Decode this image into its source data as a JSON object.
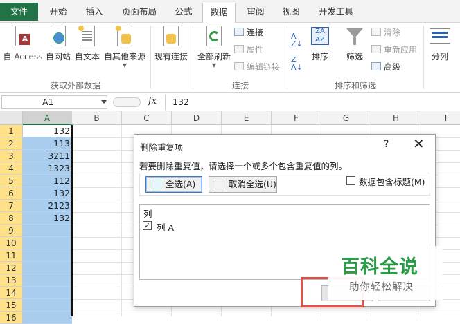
{
  "ribbon_tabs": [
    "文件",
    "开始",
    "插入",
    "页面布局",
    "公式",
    "数据",
    "审阅",
    "视图",
    "开发工具"
  ],
  "active_tab": "数据",
  "get_external": {
    "access": "自 Access",
    "web": "自网站",
    "text": "自文本",
    "other": "自其他来源",
    "group": "获取外部数据"
  },
  "existing_conn": "现有连接",
  "connections": {
    "refresh": "全部刷新",
    "conn": "连接",
    "props": "属性",
    "edit_links": "编辑链接",
    "group": "连接"
  },
  "sort_filter": {
    "sort": "排序",
    "filter": "筛选",
    "clear": "清除",
    "reapply": "重新应用",
    "advanced": "高级",
    "group": "排序和筛选"
  },
  "split": "分列",
  "name_box": "A1",
  "fx": "fx",
  "formula_value": "132",
  "columns": [
    "A",
    "B",
    "C",
    "D",
    "E",
    "F",
    "G",
    "H",
    "I"
  ],
  "rows": [
    "1",
    "2",
    "3",
    "4",
    "5",
    "6",
    "7",
    "8",
    "9",
    "10",
    "11",
    "12",
    "13",
    "14",
    "15",
    "16"
  ],
  "col_a_values": [
    "132",
    "113",
    "3211",
    "1323",
    "112",
    "132",
    "2123",
    "132"
  ],
  "dialog": {
    "title": "删除重复项",
    "help": "?",
    "close": "✕",
    "instruction": "若要删除重复值，请选择一个或多个包含重复值的列。",
    "select_all": "全选(A)",
    "unselect_all": "取消全选(U)",
    "has_headers_label": "数据包含标题(M)",
    "has_headers_checked": false,
    "list_header": "列",
    "items": [
      {
        "label": "列 A",
        "checked": true
      }
    ]
  },
  "watermark": {
    "title": "百科全说",
    "subtitle": "助你轻松解决"
  }
}
